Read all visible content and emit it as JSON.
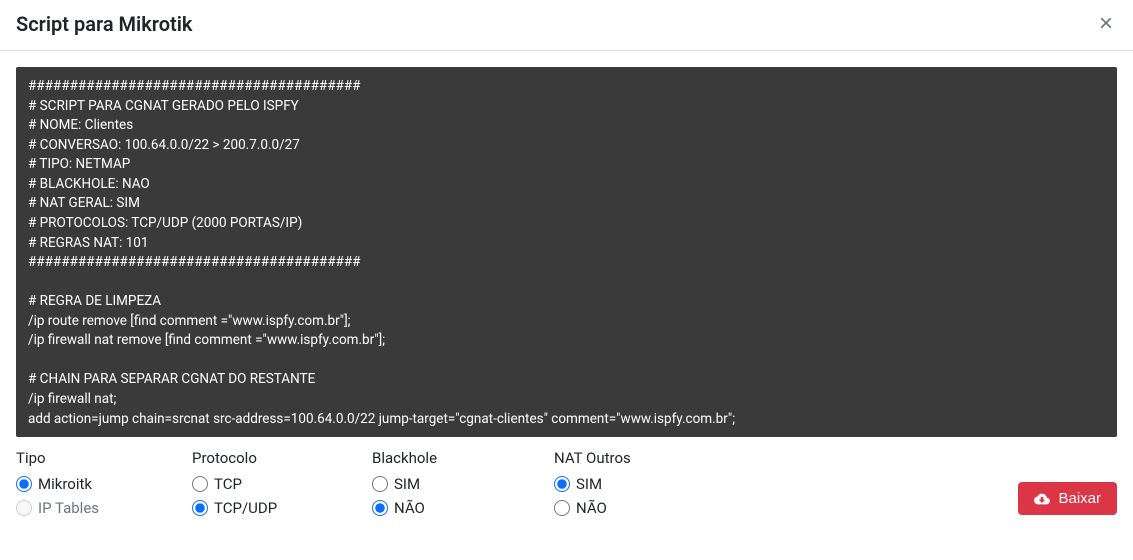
{
  "header": {
    "title": "Script para Mikrotik"
  },
  "script": {
    "content": "########################################\n# SCRIPT PARA CGNAT GERADO PELO ISPFY\n# NOME: Clientes\n# CONVERSAO: 100.64.0.0/22 > 200.7.0.0/27\n# TIPO: NETMAP\n# BLACKHOLE: NAO\n# NAT GERAL: SIM\n# PROTOCOLOS: TCP/UDP (2000 PORTAS/IP)\n# REGRAS NAT: 101\n########################################\n\n# REGRA DE LIMPEZA\n/ip route remove [find comment =\"www.ispfy.com.br\"];\n/ip firewall nat remove [find comment =\"www.ispfy.com.br\"];\n\n# CHAIN PARA SEPARAR CGNAT DO RESTANTE\n/ip firewall nat;\nadd action=jump chain=srcnat src-address=100.64.0.0/22 jump-target=\"cgnat-clientes\" comment=\"www.ispfy.com.br\";\n\n# CHAINS PARA MELHORA DE DESEMPENHO"
  },
  "controls": {
    "tipo": {
      "label": "Tipo",
      "options": [
        "Mikroitk",
        "IP Tables"
      ],
      "selected": "Mikroitk",
      "disabled": [
        "IP Tables"
      ]
    },
    "protocolo": {
      "label": "Protocolo",
      "options": [
        "TCP",
        "TCP/UDP"
      ],
      "selected": "TCP/UDP"
    },
    "blackhole": {
      "label": "Blackhole",
      "options": [
        "SIM",
        "NÃO"
      ],
      "selected": "NÃO"
    },
    "nat_outros": {
      "label": "NAT Outros",
      "options": [
        "SIM",
        "NÃO"
      ],
      "selected": "SIM"
    }
  },
  "buttons": {
    "download": "Baixar"
  }
}
